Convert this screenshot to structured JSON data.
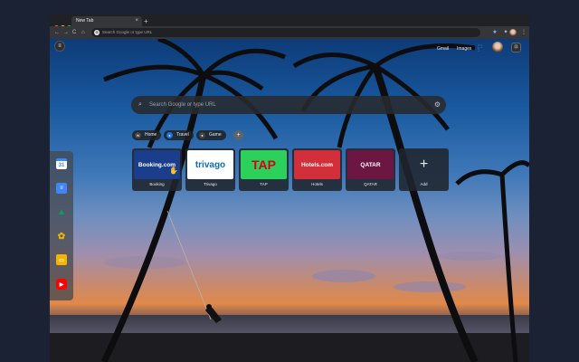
{
  "browser": {
    "tab_title": "New Tab",
    "tab_close": "×",
    "new_tab": "+",
    "back": "←",
    "forward": "→",
    "reload": "C",
    "home": "⌂",
    "address_placeholder": "Search Google or type URL",
    "address_g": "G",
    "bookmark_star": "★",
    "extension_icon": "✦",
    "menu_dots": "⋮"
  },
  "ntp": {
    "menu_glyph": "≡",
    "links": {
      "gmail": "Gmail",
      "images": "Images"
    },
    "apps_glyph": "⋮⋮⋮",
    "settings_glyph": "⊡",
    "search_placeholder": "Search Google or type URL",
    "search_glyph": "⌕",
    "search_gear": "⚙",
    "chips": [
      {
        "label": "Home",
        "icon": "W"
      },
      {
        "label": "Travel",
        "icon": "●"
      },
      {
        "label": "Game",
        "icon": "●"
      }
    ],
    "chip_add": "+",
    "tiles": [
      {
        "label": "Booking",
        "logo_text": "Booking.com",
        "bg": "#1a3d8c",
        "fg": "#ffffff"
      },
      {
        "label": "Trivago",
        "logo_text": "trivago",
        "bg": "#ffffff",
        "fg": "#0a6fb4"
      },
      {
        "label": "TAP",
        "logo_text": "TAP",
        "bg": "#2bd15a",
        "fg": "#d7001a"
      },
      {
        "label": "Hotels",
        "logo_text": "Hotels.com",
        "bg": "#d32f3a",
        "fg": "#ffffff"
      },
      {
        "label": "QATAR",
        "logo_text": "QATAR",
        "bg": "#6b1741",
        "fg": "#ffffff"
      },
      {
        "label": "Add",
        "logo_text": "+",
        "bg": "transparent",
        "fg": "#e8eaed"
      }
    ],
    "sidebar": [
      {
        "icon": "calendar-icon",
        "glyph": "31",
        "bg": "#4285f4"
      },
      {
        "icon": "docs-icon",
        "glyph": "≡",
        "bg": "#4285f4"
      },
      {
        "icon": "drive-icon",
        "glyph": "▲",
        "bg": "#0f9d58"
      },
      {
        "icon": "photos-icon",
        "glyph": "✿",
        "bg": "#f4b400"
      },
      {
        "icon": "slides-icon",
        "glyph": "▭",
        "bg": "#f4b400"
      },
      {
        "icon": "youtube-icon",
        "glyph": "▶",
        "bg": "#ff0000"
      }
    ]
  }
}
